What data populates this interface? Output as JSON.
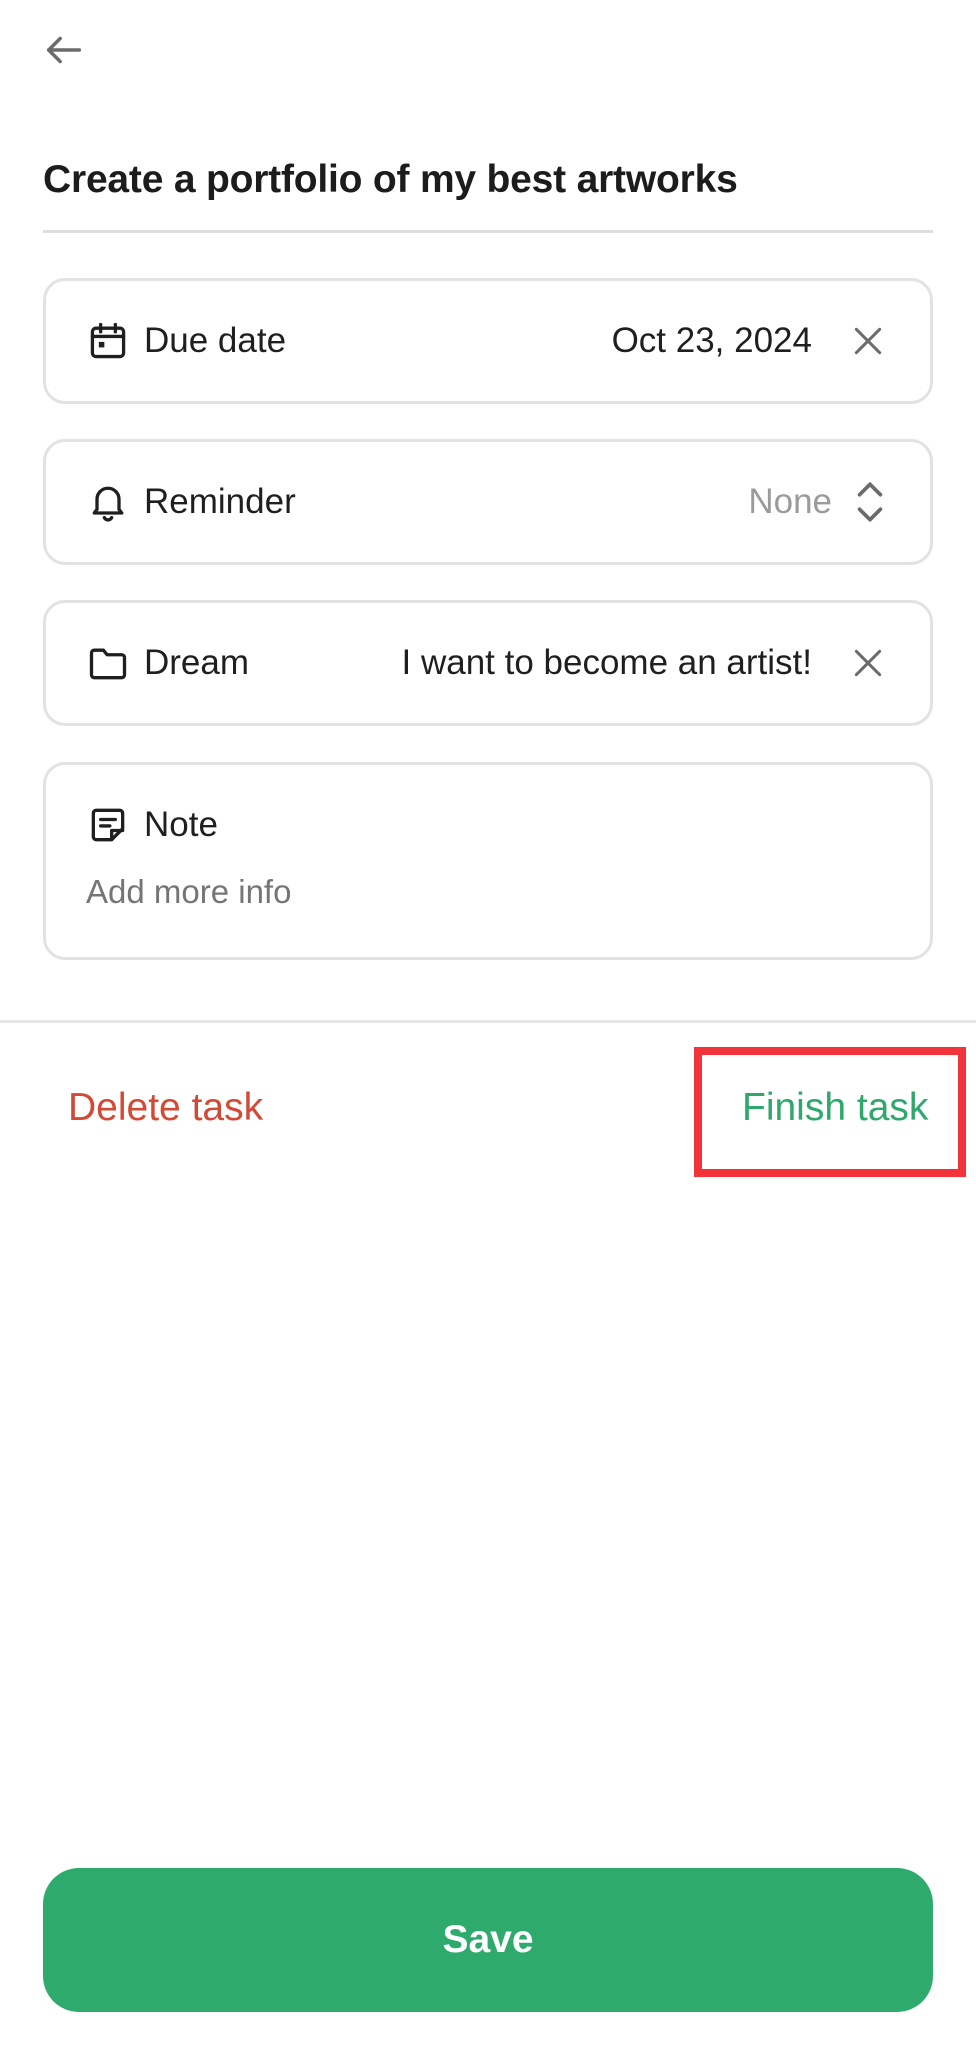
{
  "task": {
    "title": "Create a portfolio of my best artworks"
  },
  "fields": {
    "due_date": {
      "label": "Due date",
      "value": "Oct 23, 2024"
    },
    "reminder": {
      "label": "Reminder",
      "value": "None"
    },
    "dream": {
      "label": "Dream",
      "value": "I want to become an artist!"
    },
    "note": {
      "label": "Note",
      "placeholder": "Add more info"
    }
  },
  "actions": {
    "delete_label": "Delete task",
    "finish_label": "Finish task",
    "save_label": "Save"
  },
  "icons": {
    "back": "arrow-left-icon",
    "due_date": "calendar-icon",
    "reminder": "bell-icon",
    "dream": "folder-icon",
    "note": "note-icon",
    "clear": "close-icon",
    "stepper": "chevron-up-down-icon"
  },
  "colors": {
    "accent_green": "#2eab6c",
    "delete_red": "#d24a36",
    "highlight_red": "#f2343a",
    "muted_text": "#9b9b9b"
  }
}
